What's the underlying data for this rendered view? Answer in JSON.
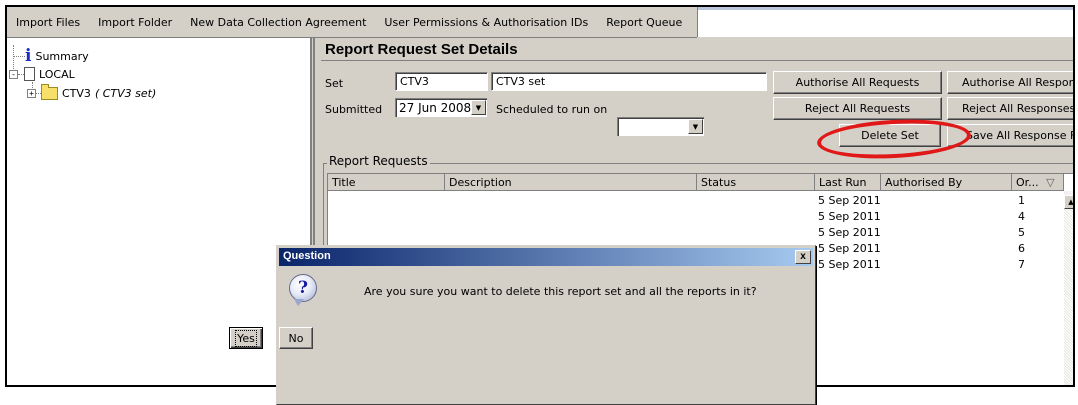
{
  "menu": {
    "items": [
      "Import Files",
      "Import Folder",
      "New Data Collection Agreement",
      "User Permissions & Authorisation IDs",
      "Report Queue"
    ]
  },
  "tree": {
    "summary": "Summary",
    "local": "LOCAL",
    "ctv3_name": "CTV3",
    "ctv3_desc": "( CTV3 set)"
  },
  "details": {
    "heading": "Report Request Set Details",
    "set_label": "Set",
    "set_code": "CTV3",
    "set_name": "CTV3 set",
    "submitted_label": "Submitted",
    "submitted_value": "27 Jun 2008",
    "scheduled_label": "Scheduled to run on",
    "scheduled_value": "",
    "buttons": {
      "authorise_all_requests": "Authorise All Requests",
      "authorise_all_responses": "Authorise All Responses",
      "reject_all_requests": "Reject All Requests",
      "reject_all_responses": "Reject All Responses",
      "delete_set": "Delete Set",
      "save_all_response_files": "Save All Response Files"
    },
    "highlight_color": "#e01818"
  },
  "requests": {
    "group_title": "Report Requests",
    "columns": [
      "Title",
      "Description",
      "Status",
      "Last Run",
      "Authorised By",
      "Or..."
    ],
    "sort_indicator": "▽",
    "rows": [
      {
        "last_run": "5 Sep 2011",
        "order": "1"
      },
      {
        "last_run": "5 Sep 2011",
        "order": "4"
      },
      {
        "last_run": "5 Sep 2011",
        "order": "5"
      },
      {
        "last_run": "5 Sep 2011",
        "order": "6"
      },
      {
        "last_run": "5 Sep 2011",
        "order": "7"
      }
    ]
  },
  "dialog": {
    "title": "Question",
    "close": "x",
    "icon": "?",
    "message": "Are you sure you want to delete this report set and all the reports in it?",
    "yes": "Yes",
    "no": "No"
  }
}
